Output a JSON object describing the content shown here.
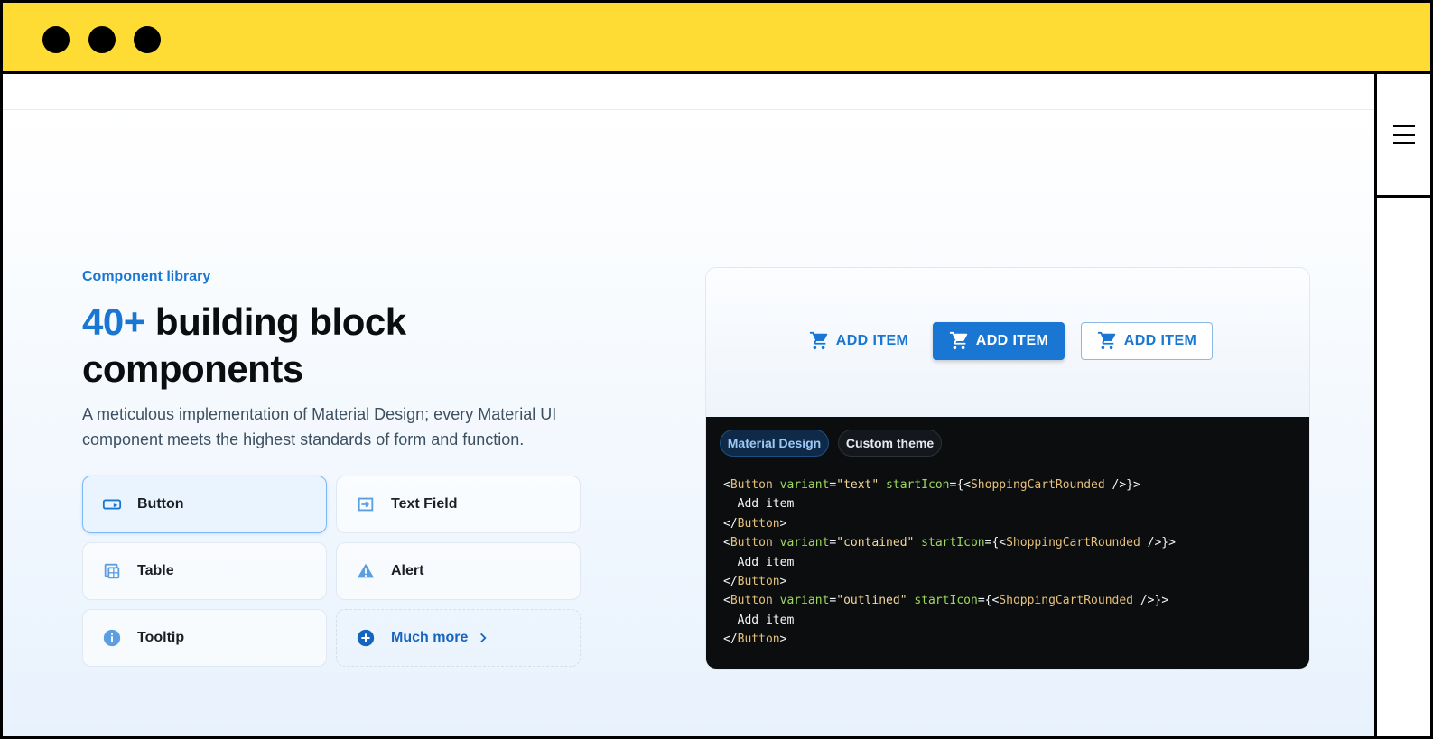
{
  "window": {
    "controls": [
      "window-dot",
      "window-dot",
      "window-dot"
    ]
  },
  "hero": {
    "eyebrow": "Component library",
    "headline_accent": "40+",
    "headline_rest": " building block components",
    "subtitle": "A meticulous implementation of Material Design; every Material UI component meets the highest standards of form and function."
  },
  "components": [
    {
      "label": "Button",
      "icon": "button-icon",
      "selected": true
    },
    {
      "label": "Text Field",
      "icon": "text-field-icon",
      "selected": false
    },
    {
      "label": "Table",
      "icon": "table-icon",
      "selected": false
    },
    {
      "label": "Alert",
      "icon": "warning-icon",
      "selected": false
    },
    {
      "label": "Tooltip",
      "icon": "info-icon",
      "selected": false
    },
    {
      "label": "Much more",
      "icon": "add-circle-icon",
      "selected": false
    }
  ],
  "demo": {
    "buttons": {
      "text_label": "ADD ITEM",
      "contained_label": "ADD ITEM",
      "outlined_label": "ADD ITEM",
      "icon": "shopping-cart-icon"
    },
    "chips": {
      "material": "Material Design",
      "custom": "Custom theme"
    },
    "code": {
      "lt": "<",
      "lt_slash": "</",
      "gt": ">",
      "tag": "Button",
      "variant_attr": "variant",
      "eq": "=",
      "variant_text": "\"text\"",
      "variant_contained": "\"contained\"",
      "variant_outlined": "\"outlined\"",
      "icon_attr": "startIcon",
      "icon_open": "={<",
      "icon_name": "ShoppingCartRounded",
      "icon_close": " />}",
      "child": "  Add item"
    }
  },
  "colors": {
    "window_bar": "#FFDC33",
    "primary": "#1976D2",
    "code_bg": "#0B0D0E"
  }
}
